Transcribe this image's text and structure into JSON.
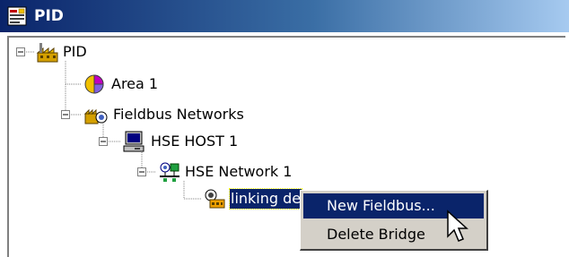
{
  "window": {
    "title": "PID",
    "title_icon": "document-properties-icon"
  },
  "tree": {
    "nodes": [
      {
        "label": "PID",
        "icon": "plant-factory-icon",
        "expanded": true
      },
      {
        "label": "Area 1",
        "icon": "pie-chart-icon"
      },
      {
        "label": "Fieldbus Networks",
        "icon": "fieldbus-network-icon",
        "expanded": true
      },
      {
        "label": "HSE HOST 1",
        "icon": "computer-icon",
        "expanded": true
      },
      {
        "label": "HSE Network 1",
        "icon": "network-icon",
        "expanded": true
      },
      {
        "label": "linking de",
        "icon": "linking-device-icon",
        "selected": true
      }
    ]
  },
  "context_menu": {
    "items": [
      {
        "label": "New Fieldbus...",
        "highlighted": true
      },
      {
        "label": "Delete Bridge",
        "highlighted": false
      }
    ]
  },
  "colors": {
    "title_start": "#0a246a",
    "title_end": "#a6caf0",
    "selection": "#0a246a",
    "menu_bg": "#d4d0c8"
  }
}
